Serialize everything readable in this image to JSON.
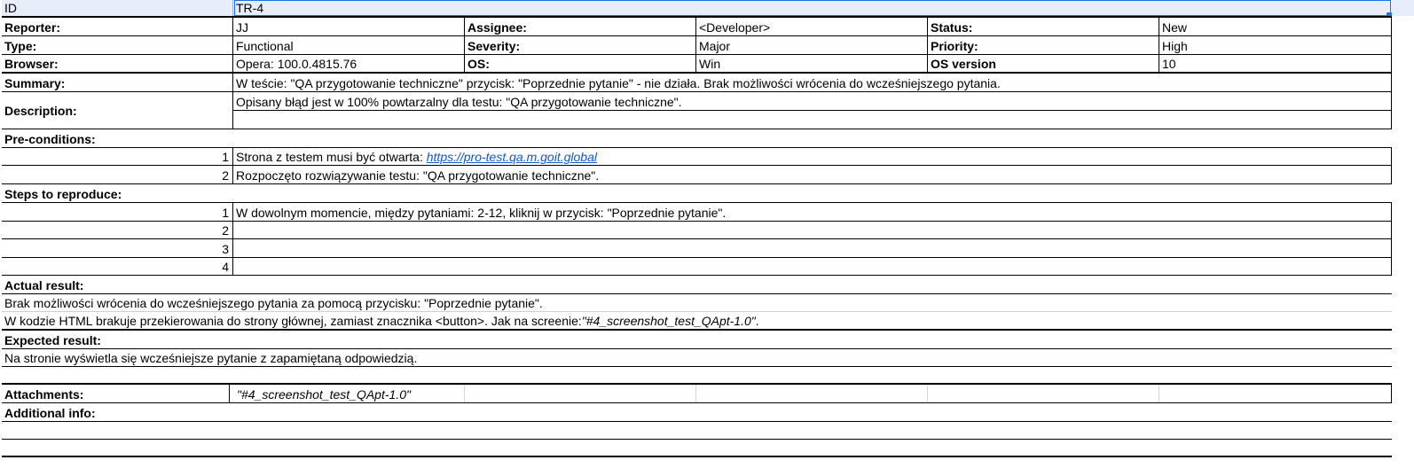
{
  "header": {
    "id_label": "ID",
    "id_value": "TR-4"
  },
  "meta": {
    "reporter_label": "Reporter:",
    "reporter_value": "JJ",
    "assignee_label": "Assignee:",
    "assignee_value": "<Developer>",
    "status_label": "Status:",
    "status_value": "New",
    "type_label": "Type:",
    "type_value": "Functional",
    "severity_label": "Severity:",
    "severity_value": "Major",
    "priority_label": "Priority:",
    "priority_value": "High",
    "browser_label": "Browser:",
    "browser_value": "Opera: 100.0.4815.76",
    "os_label": "OS:",
    "os_value": "Win",
    "osversion_label": "OS version",
    "osversion_value": "10"
  },
  "summary": {
    "label": "Summary:",
    "value": "W teście: \"QA przygotowanie techniczne\" przycisk: \"Poprzednie pytanie\" - nie działa. Brak możliwości wrócenia do wcześniejszego pytania."
  },
  "description": {
    "label": "Description:",
    "value": "Opisany błąd jest w 100% powtarzalny dla testu: \"QA przygotowanie techniczne\"."
  },
  "preconditions": {
    "label": "Pre-conditions:",
    "items": [
      {
        "num": "1",
        "text": "Strona z testem musi być otwarta: ",
        "link": "https://pro-test.qa.m.goit.global"
      },
      {
        "num": "2",
        "text": "Rozpoczęto rozwiązywanie testu: \"QA przygotowanie techniczne\"."
      }
    ]
  },
  "steps": {
    "label": "Steps to reproduce:",
    "items": [
      {
        "num": "1",
        "text": "W dowolnym momencie, między pytaniami: 2-12, kliknij w przycisk: \"Poprzednie pytanie\"."
      },
      {
        "num": "2",
        "text": ""
      },
      {
        "num": "3",
        "text": ""
      },
      {
        "num": "4",
        "text": ""
      }
    ]
  },
  "actual": {
    "label": "Actual result:",
    "line1": "Brak możliwości wrócenia do wcześniejszego pytania za pomocą przycisku: \"Poprzednie pytanie\".",
    "line2_prefix": "W kodzie HTML brakuje przekierowania do strony głównej, zamiast znacznika <button>. Jak na screenie: ",
    "line2_italic": "\"#4_screenshot_test_QApt-1.0\"",
    "line2_suffix": "."
  },
  "expected": {
    "label": "Expected result:",
    "line1": "Na stronie wyświetla się wcześniejsze pytanie z zapamiętaną odpowiedzią."
  },
  "attachments": {
    "label": "Attachments:",
    "value": "\"#4_screenshot_test_QApt-1.0\""
  },
  "additional": {
    "label": "Additional info:"
  },
  "colors": {
    "selection": "#1a73e8",
    "header_fill": "#e8edfa",
    "link": "#1155cc"
  }
}
